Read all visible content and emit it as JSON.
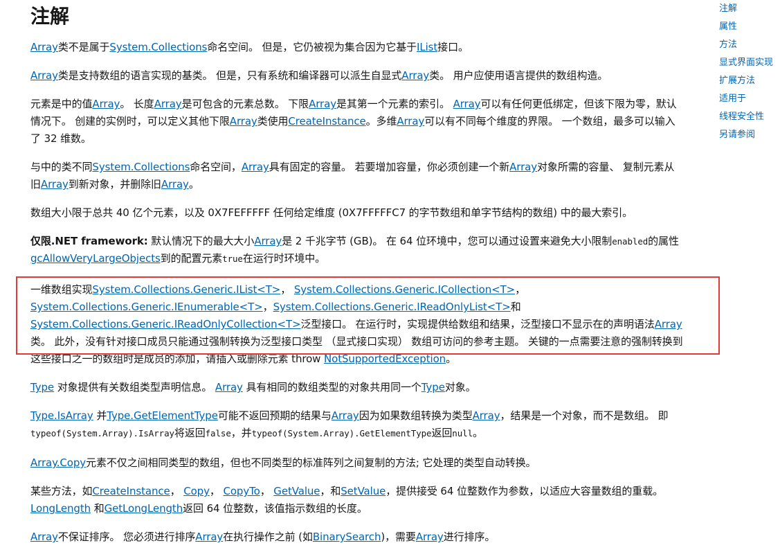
{
  "page": {
    "title": "注解"
  },
  "toc": {
    "items": [
      "注解",
      "属性",
      "方法",
      "显式界面实现",
      "扩展方法",
      "适用于",
      "线程安全性",
      "另请参阅"
    ]
  },
  "paragraphs": {
    "p1": {
      "l1": "Array",
      "t1": "类不是属于",
      "l2": "System.Collections",
      "t2": "命名空间。 但是，它仍被视为集合因为它基于",
      "l3": "IList",
      "t3": "接口。"
    },
    "p2": {
      "l1": "Array",
      "t1": "类是支持数组的语言实现的基类。 但是，只有系统和编译器可以派生自显式",
      "l2": "Array",
      "t2": "类。 用户应使用语言提供的数组构造。"
    },
    "p3": {
      "t1": "元素是中的值",
      "l1": "Array",
      "t2": "。 长度",
      "l2": "Array",
      "t3": "是可包含的元素总数。 下限",
      "l3": "Array",
      "t4": "是其第一个元素的索引。 ",
      "l4": "Array",
      "t5": "可以有任何更低绑定，但该下限为零，默认情况下。 创建的实例时，可以定义其他下限",
      "l5": "Array",
      "t6": "类使用",
      "l6": "CreateInstance",
      "t7": "。多维",
      "l7": "Array",
      "t8": "可以有不同每个维度的界限。 一个数组，最多可以输入了 32 维数。"
    },
    "p4": {
      "t1": "与中的类不同",
      "l1": "System.Collections",
      "t2": "命名空间，",
      "l2": "Array",
      "t3": "具有固定的容量。 若要增加容量，你必须创建一个新",
      "l3": "Array",
      "t4": "对象所需的容量、 复制元素从旧",
      "l4": "Array",
      "t5": "到新对象，并删除旧",
      "l5": "Array",
      "t6": "。"
    },
    "p5": {
      "t1": "数组大小限于总共 40 亿个元素，以及 0X7FEFFFFF 任何给定维度 (0X7FFFFFC7 的字节数组和单字节结构的数组) 中的最大索引。"
    },
    "p6": {
      "b1": "仅限.NET framework:",
      "t1": " 默认情况下的最大大小",
      "l1": "Array",
      "t2": "是 2 千兆字节 (GB)。 在 64 位环境中，您可以通过设置来避免大小限制",
      "c1": "enabled",
      "t3": "的属性",
      "l2": "gcAllowVeryLargeObjects",
      "t4": "到的配置元素",
      "c2": "true",
      "t5": "在运行时环境中。"
    },
    "p7": {
      "t1": "一维数组实现",
      "l1": "System.Collections.Generic.IList<T>",
      "t2": "， ",
      "l2": "System.Collections.Generic.ICollection<T>",
      "t3": "，",
      "l3": "System.Collections.Generic.IEnumerable<T>",
      "t4": "，",
      "l4": "System.Collections.Generic.IReadOnlyList<T>",
      "t5": "和",
      "l5": "System.Collections.Generic.IReadOnlyCollection<T>",
      "t6": "泛型接口。 在运行时，实现提供给数组和结果，泛型接口不显示在的声明语法",
      "l6": "Array",
      "t7": "类。 此外，没有针对接口成员只能通过强制转换为泛型接口类型 （显式接口实现） 数组可访问的参考主题。 关键的一点需要注意的强制转换到这些接口之一的数组时是成员的添加，请插入或删除元素 throw ",
      "l7": "NotSupportedException",
      "t8": "。"
    },
    "p8": {
      "l1": "Type",
      "t1": " 对象提供有关数组类型声明信息。 ",
      "l2": "Array",
      "t2": " 具有相同的数组类型的对象共用同一个",
      "l3": "Type",
      "t3": "对象。"
    },
    "p9": {
      "l1": "Type.IsArray",
      "t1": " 并",
      "l2": "Type.GetElementType",
      "t2": "可能不返回预期的结果与",
      "l3": "Array",
      "t3": "因为如果数组转换为类型",
      "l4": "Array",
      "t4": "，结果是一个对象，而不是数组。 即",
      "c1": "typeof(System.Array).IsArray",
      "t5": "将返回",
      "c2": "false",
      "t6": "，并",
      "c3": "typeof(System.Array).GetElementType",
      "t7": "返回",
      "c4": "null",
      "t8": "。"
    },
    "p10": {
      "l1": "Array.Copy",
      "t1": "元素不仅之间相同类型的数组，但也不同类型的标准阵列之间复制的方法; 它处理的类型自动转换。"
    },
    "p11": {
      "t1": "某些方法，如",
      "l1": "CreateInstance",
      "t2": "， ",
      "l2": "Copy",
      "t3": "， ",
      "l3": "CopyTo",
      "t4": "， ",
      "l4": "GetValue",
      "t5": "，和",
      "l5": "SetValue",
      "t6": "，提供接受 64 位整数作为参数，以适应大容量数组的重载。 ",
      "l6": "LongLength",
      "t7": " 和",
      "l7": "GetLongLength",
      "t8": "返回 64 位整数，该值指示数组的长度。"
    },
    "p12": {
      "l1": "Array",
      "t1": "不保证排序。 您必须进行排序",
      "l2": "Array",
      "t2": "在执行操作之前 (如",
      "l3": "BinarySearch",
      "t3": ")，需要",
      "l4": "Array",
      "t4": "进行排序。"
    }
  },
  "colors": {
    "link": "#0065b3",
    "text": "#171717",
    "highlight_border": "#e53935"
  }
}
